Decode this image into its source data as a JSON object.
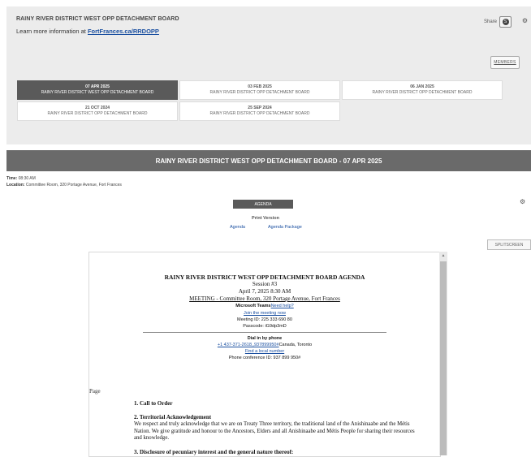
{
  "header": {
    "org_title": "RAINY RIVER DISTRICT WEST OPP DETACHMENT BOARD",
    "learn_prefix": "Learn more information at ",
    "learn_link": "FortFrances.ca/RRDOPP",
    "share_label": "Share",
    "members_label": "MEMBERS"
  },
  "meetings": [
    {
      "date": "07 APR 2025",
      "name": "RAINY RIVER DISTRICT WEST OPP DETACHMENT BOARD",
      "active": true
    },
    {
      "date": "03 FEB 2025",
      "name": "RAINY RIVER DISTRICT OPP DETACHMENT BOARD",
      "active": false
    },
    {
      "date": "06 JAN 2025",
      "name": "RAINY RIVER DISTRICT OPP DETACHMENT BOARD",
      "active": false
    },
    {
      "date": "21 OCT 2024",
      "name": "RAINY RIVER DISTRICT OPP DETACHMENT BOARD",
      "active": false
    },
    {
      "date": "25 SEP 2024",
      "name": "RAINY RIVER DISTRICT OPP DETACHMENT BOARD",
      "active": false
    }
  ],
  "meeting_banner": "RAINY RIVER DISTRICT WEST OPP DETACHMENT BOARD - 07 APR 2025",
  "details": {
    "time_label": "Time:",
    "time_value": " 08:30 AM",
    "location_label": "Location:",
    "location_value": " Committee Room, 320 Portage Avenue, Fort Frances"
  },
  "agenda_button": "AGENDA",
  "print_version": {
    "title": "Print Version",
    "agenda_link": "Agenda",
    "package_link": "Agenda Package"
  },
  "splitscreen_label": "SPLITSCREEN",
  "document": {
    "title": "RAINY RIVER DISTRICT WEST OPP DETACHMENT BOARD AGENDA",
    "session": "Session #3",
    "datetime": "April 7, 2025 8:30 AM",
    "meeting_location": "MEETING - Committee Room, 320 Portage Avenue, Fort Frances",
    "teams_label": "Microsoft Teams",
    "teams_help": "Need help?",
    "join_link": "Join the meeting now",
    "meeting_id": "Meeting ID: 225 333 690 80",
    "passcode": "Passcode: iG9dp3mD",
    "dial_heading": "Dial in by phone",
    "phone_link": "+1 437-371-2618,,937899950#",
    "phone_suffix": "Canada, Toronto",
    "local_number_link": "Find a local number",
    "conference_id": "Phone conference ID: 937 899 950#",
    "page_label": "Page",
    "sections": [
      {
        "heading": "1. Call to Order",
        "body": ""
      },
      {
        "heading": "2. Territorial Acknowledgement",
        "body": "We respect and truly acknowledge that we are on Treaty Three territory, the traditional land of the Anishinaabe and the Métis Nation. We give gratitude and honour to the Ancestors, Elders and all Anishinaabe and Métis People for sharing their resources and knowledge."
      },
      {
        "heading": "3. Disclosure of pecuniary interest and the general nature thereof:",
        "body": ""
      }
    ]
  }
}
